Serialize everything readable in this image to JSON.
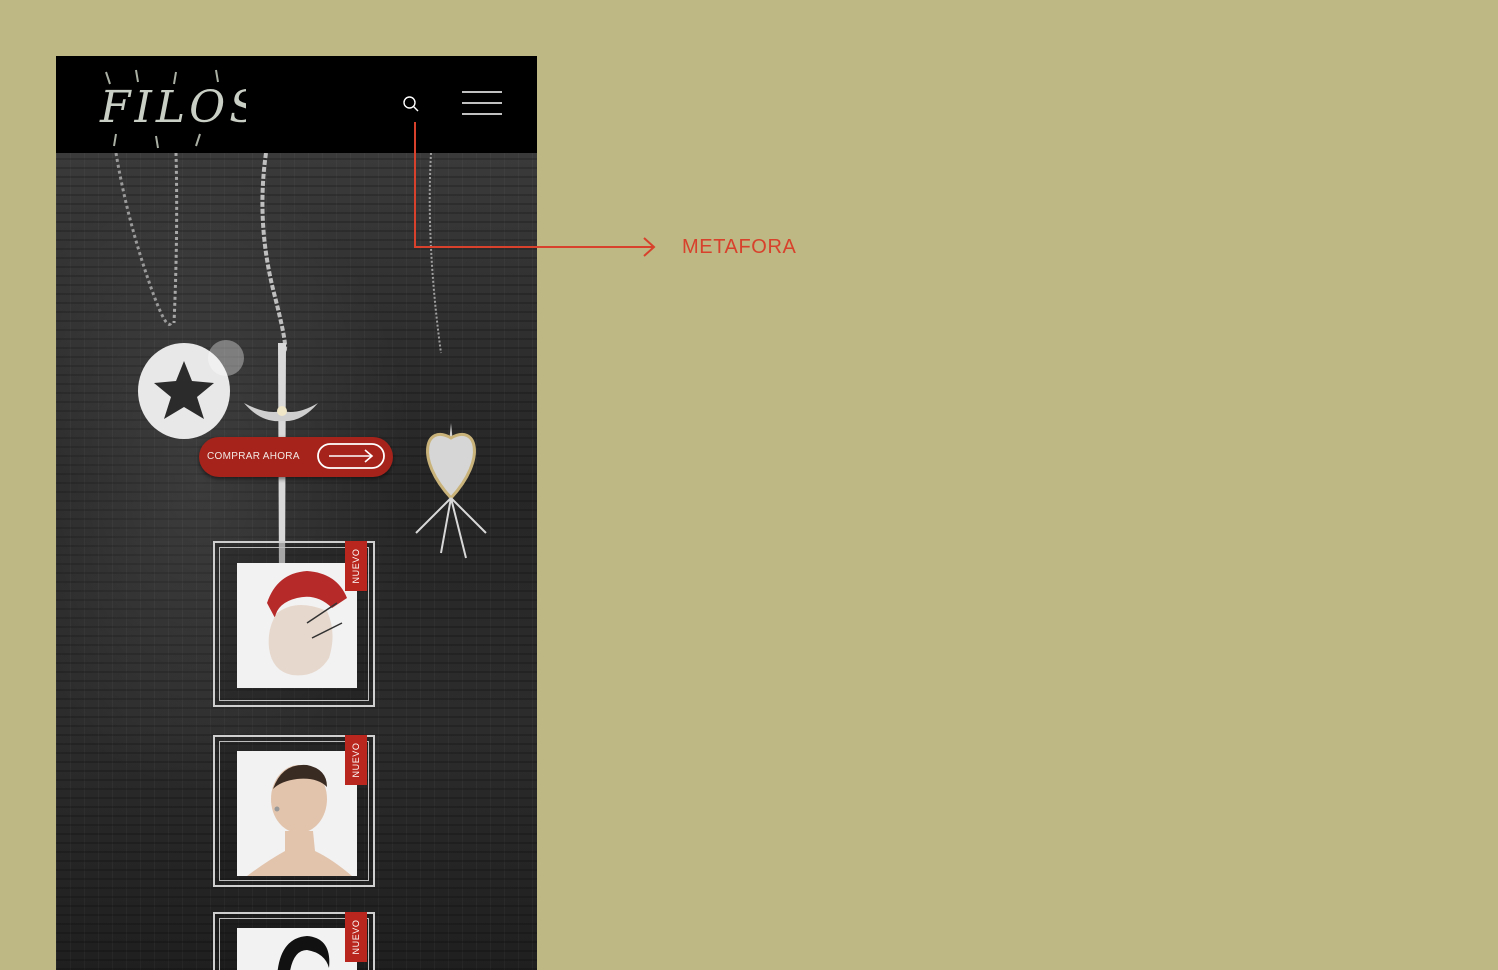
{
  "brand": {
    "logo_text": "FILOSA"
  },
  "navbar": {
    "search_icon": "search-icon",
    "menu_icon": "hamburger-menu-icon"
  },
  "hero": {
    "cta_label": "COMPRAR AHORA",
    "cta_icon": "arrow-right-icon"
  },
  "products": [
    {
      "badge": "NUEVO",
      "image": "red-mohawk-model-photo"
    },
    {
      "badge": "NUEVO",
      "image": "short-hair-man-earring-photo"
    },
    {
      "badge": "NUEVO",
      "image": "black-hair-model-photo"
    }
  ],
  "annotation": {
    "label": "METAFORA"
  },
  "colors": {
    "background": "#bdb884",
    "accent": "#b8261d",
    "annotation": "#d8412c",
    "navbar": "#000000"
  }
}
